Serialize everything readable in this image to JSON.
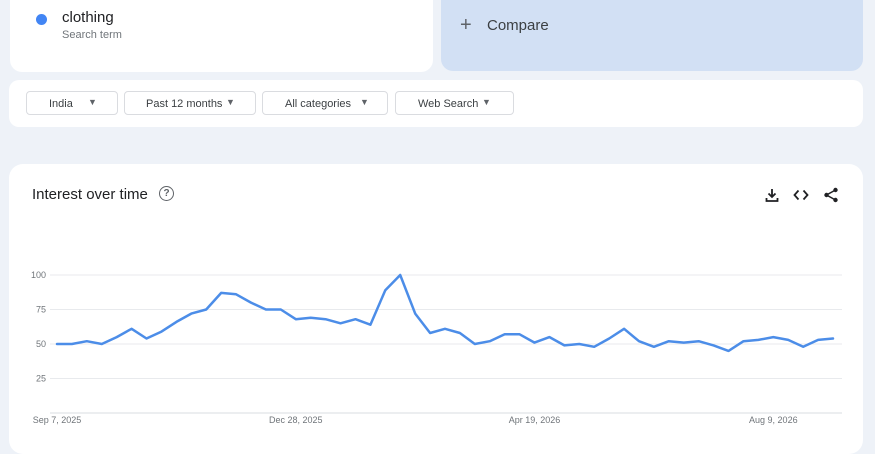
{
  "search_term": {
    "name": "clothing",
    "subtitle": "Search term",
    "color": "#4285f4"
  },
  "compare": {
    "plus": "+",
    "label": "Compare"
  },
  "filters": [
    {
      "label": "India"
    },
    {
      "label": "Past 12 months"
    },
    {
      "label": "All categories"
    },
    {
      "label": "Web Search"
    }
  ],
  "chart": {
    "title": "Interest over time"
  },
  "chart_data": {
    "type": "line",
    "title": "Interest over time",
    "ylim": [
      0,
      100
    ],
    "yticks": [
      25,
      50,
      75,
      100
    ],
    "grid": true,
    "xtick_labels": [
      {
        "label": "Sep 7, 2025",
        "index": 0
      },
      {
        "label": "Dec 28, 2025",
        "index": 16
      },
      {
        "label": "Apr 19, 2026",
        "index": 32
      },
      {
        "label": "Aug 9, 2026",
        "index": 48
      }
    ],
    "series": [
      {
        "color": "#4c8de8",
        "values": [
          50,
          50,
          52,
          50,
          55,
          61,
          54,
          59,
          66,
          72,
          75,
          87,
          86,
          80,
          75,
          75,
          68,
          69,
          68,
          65,
          68,
          64,
          89,
          100,
          72,
          58,
          61,
          58,
          50,
          52,
          57,
          57,
          51,
          55,
          49,
          50,
          48,
          54,
          61,
          52,
          48,
          52,
          51,
          52,
          49,
          45,
          52,
          53,
          55,
          53,
          48,
          53,
          54
        ]
      }
    ]
  }
}
